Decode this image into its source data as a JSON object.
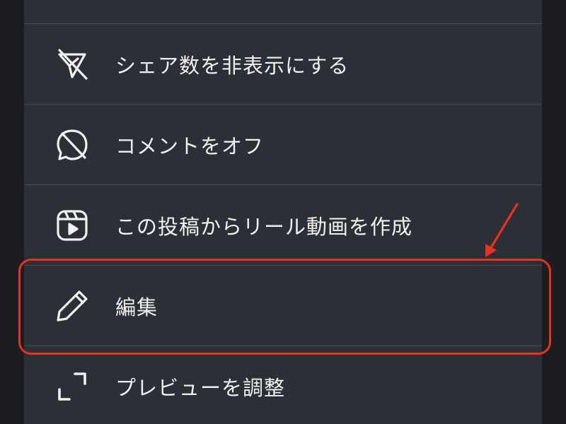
{
  "menu": {
    "items": [
      {
        "label": "シェア数を非表示にする",
        "icon": "share-count-hidden-icon"
      },
      {
        "label": "コメントをオフ",
        "icon": "comments-off-icon"
      },
      {
        "label": "この投稿からリール動画を作成",
        "icon": "reels-icon"
      },
      {
        "label": "編集",
        "icon": "pencil-edit-icon"
      },
      {
        "label": "プレビューを調整",
        "icon": "adjust-preview-icon"
      }
    ]
  },
  "annotation": {
    "highlight_color": "#e8321f",
    "highlighted_item": "編集"
  },
  "colors": {
    "sheet_background": "#2c2f36",
    "outer_background": "#1c1d21",
    "text": "#f1f1f3",
    "divider": "#474b54"
  }
}
